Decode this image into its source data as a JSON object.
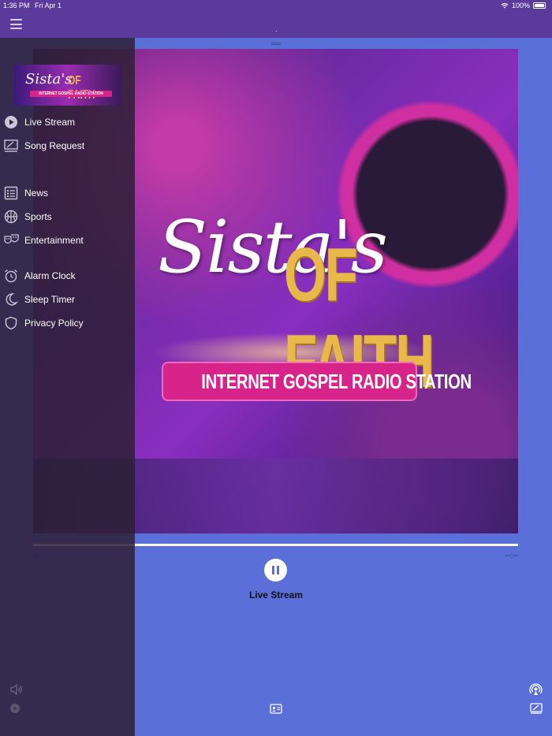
{
  "status_bar": {
    "time": "1:36 PM",
    "date": "Fri Apr 1",
    "battery": "100%"
  },
  "header": {
    "title": "."
  },
  "player": {
    "artwork": {
      "script_text": "Sista's",
      "title_text": "OF FAITH",
      "banner_text": "INTERNET GOSPEL RADIO STATION"
    },
    "progress": 1.0,
    "elapsed": "--:--",
    "remaining": "--:--",
    "now_playing": "Live Stream"
  },
  "drawer": {
    "logo": {
      "script_text": "Sista's",
      "title_text": "OF FAITH",
      "banner_text": "INTERNET GOSPEL RADIO STATION"
    },
    "items": [
      {
        "label": "Live Stream",
        "icon": "play-circle-icon"
      },
      {
        "label": "Song Request",
        "icon": "song-request-icon"
      },
      {
        "label": "News",
        "icon": "news-icon"
      },
      {
        "label": "Sports",
        "icon": "basketball-icon"
      },
      {
        "label": "Entertainment",
        "icon": "theater-masks-icon"
      },
      {
        "label": "Alarm Clock",
        "icon": "alarm-clock-icon"
      },
      {
        "label": "Sleep Timer",
        "icon": "moon-icon"
      },
      {
        "label": "Privacy Policy",
        "icon": "shield-icon"
      }
    ]
  },
  "colors": {
    "header": "#5a3a9a",
    "background": "#5a6fd8",
    "drawer": "#2d2037",
    "banner": "#d8238a",
    "gold": "#e8b84a"
  }
}
